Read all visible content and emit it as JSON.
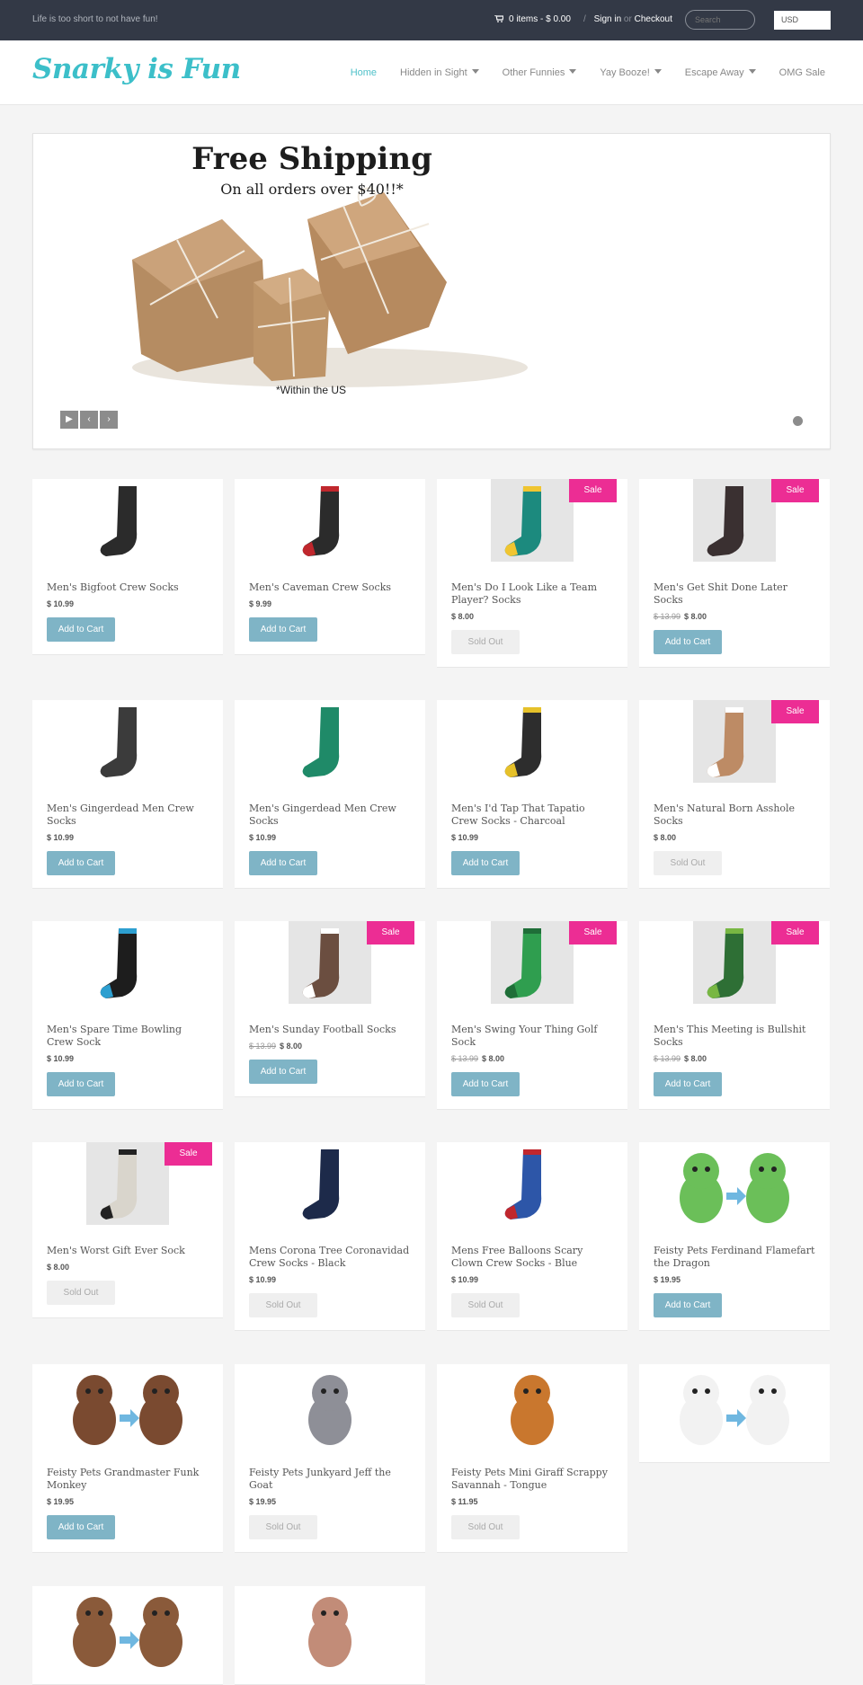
{
  "topbar": {
    "tagline": "Life is too short to not have fun!",
    "cart_text": "0 items - $ 0.00",
    "sign_in": "Sign in",
    "or": "or",
    "checkout": "Checkout",
    "search_placeholder": "Search",
    "currency": "USD"
  },
  "header": {
    "logo": "Snarky is Fun",
    "nav": [
      {
        "label": "Home",
        "active": true,
        "dropdown": false
      },
      {
        "label": "Hidden in Sight",
        "active": false,
        "dropdown": true
      },
      {
        "label": "Other Funnies",
        "active": false,
        "dropdown": true
      },
      {
        "label": "Yay Booze!",
        "active": false,
        "dropdown": true
      },
      {
        "label": "Escape Away",
        "active": false,
        "dropdown": true
      },
      {
        "label": "OMG Sale",
        "active": false,
        "dropdown": false
      }
    ]
  },
  "slider": {
    "title": "Free Shipping",
    "subtitle": "On all orders over $40!!*",
    "note": "*Within the US"
  },
  "colors": {
    "accent": "#3cbfc9",
    "topbar": "#333946",
    "sale_badge": "#ec2d94",
    "button": "#7fb4c6"
  },
  "products": [
    {
      "name": "Men's Bigfoot Crew Socks",
      "price": "$ 10.99",
      "old_price": "",
      "sale": false,
      "button": "Add to Cart",
      "sold_out": false
    },
    {
      "name": "Men's Caveman Crew Socks",
      "price": "$ 9.99",
      "old_price": "",
      "sale": false,
      "button": "Add to Cart",
      "sold_out": false
    },
    {
      "name": "Men's Do I Look Like a Team Player? Socks",
      "price": "$ 8.00",
      "old_price": "",
      "sale": true,
      "button": "Sold Out",
      "sold_out": true
    },
    {
      "name": "Men's Get Shit Done Later Socks",
      "price": "$ 8.00",
      "old_price": "$ 13.99",
      "sale": true,
      "button": "Add to Cart",
      "sold_out": false
    },
    {
      "name": "Men's Gingerdead Men Crew Socks",
      "price": "$ 10.99",
      "old_price": "",
      "sale": false,
      "button": "Add to Cart",
      "sold_out": false
    },
    {
      "name": "Men's Gingerdead Men Crew Socks",
      "price": "$ 10.99",
      "old_price": "",
      "sale": false,
      "button": "Add to Cart",
      "sold_out": false
    },
    {
      "name": "Men's I'd Tap That Tapatio Crew Socks - Charcoal",
      "price": "$ 10.99",
      "old_price": "",
      "sale": false,
      "button": "Add to Cart",
      "sold_out": false
    },
    {
      "name": "Men's Natural Born Asshole Socks",
      "price": "$ 8.00",
      "old_price": "",
      "sale": true,
      "button": "Sold Out",
      "sold_out": true
    },
    {
      "name": "Men's Spare Time Bowling Crew Sock",
      "price": "$ 10.99",
      "old_price": "",
      "sale": false,
      "button": "Add to Cart",
      "sold_out": false
    },
    {
      "name": "Men's Sunday Football Socks",
      "price": "$ 8.00",
      "old_price": "$ 13.99",
      "sale": true,
      "button": "Add to Cart",
      "sold_out": false
    },
    {
      "name": "Men's Swing Your Thing Golf Sock",
      "price": "$ 8.00",
      "old_price": "$ 13.99",
      "sale": true,
      "button": "Add to Cart",
      "sold_out": false
    },
    {
      "name": "Men's This Meeting is Bullshit Socks",
      "price": "$ 8.00",
      "old_price": "$ 13.99",
      "sale": true,
      "button": "Add to Cart",
      "sold_out": false
    },
    {
      "name": "Men's Worst Gift Ever Sock",
      "price": "$ 8.00",
      "old_price": "",
      "sale": true,
      "button": "Sold Out",
      "sold_out": true
    },
    {
      "name": "Mens Corona Tree Coronavidad Crew Socks - Black",
      "price": "$ 10.99",
      "old_price": "",
      "sale": false,
      "button": "Sold Out",
      "sold_out": true
    },
    {
      "name": "Mens Free Balloons Scary Clown Crew Socks - Blue",
      "price": "$ 10.99",
      "old_price": "",
      "sale": false,
      "button": "Sold Out",
      "sold_out": true
    },
    {
      "name": "Feisty Pets Ferdinand Flamefart the Dragon",
      "price": "$ 19.95",
      "old_price": "",
      "sale": false,
      "button": "Add to Cart",
      "sold_out": false
    },
    {
      "name": "Feisty Pets Grandmaster Funk Monkey",
      "price": "$ 19.95",
      "old_price": "",
      "sale": false,
      "button": "Add to Cart",
      "sold_out": false
    },
    {
      "name": "Feisty Pets Junkyard Jeff the Goat",
      "price": "$ 19.95",
      "old_price": "",
      "sale": false,
      "button": "Sold Out",
      "sold_out": true
    },
    {
      "name": "Feisty Pets Mini Giraff Scrappy Savannah - Tongue",
      "price": "$ 11.95",
      "old_price": "",
      "sale": false,
      "button": "Sold Out",
      "sold_out": true
    },
    {
      "name": "",
      "price": "",
      "old_price": "",
      "sale": false,
      "button": "",
      "sold_out": false
    },
    {
      "name": "",
      "price": "",
      "old_price": "",
      "sale": false,
      "button": "",
      "sold_out": false
    },
    {
      "name": "",
      "price": "",
      "old_price": "",
      "sale": false,
      "button": "",
      "sold_out": false
    }
  ],
  "sale_label": "Sale"
}
